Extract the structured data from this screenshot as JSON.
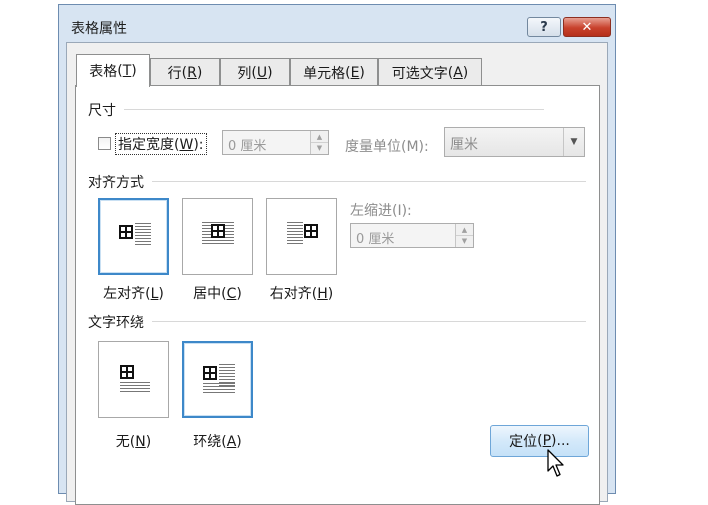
{
  "window": {
    "title": "表格属性",
    "help_label": "?",
    "close_label": "✕"
  },
  "tabs": [
    {
      "label": "表格",
      "hotkey": "T",
      "active": true
    },
    {
      "label": "行",
      "hotkey": "R",
      "active": false
    },
    {
      "label": "列",
      "hotkey": "U",
      "active": false
    },
    {
      "label": "单元格",
      "hotkey": "E",
      "active": false
    },
    {
      "label": "可选文字",
      "hotkey": "A",
      "active": false
    }
  ],
  "size_section": {
    "heading": "尺寸",
    "preferred_width_label": "指定宽度",
    "preferred_width_hotkey": "W",
    "preferred_width_checked": false,
    "width_value": "0 厘米",
    "measure_label": "度量单位(M):",
    "measure_value": "厘米"
  },
  "alignment_section": {
    "heading": "对齐方式",
    "options": [
      {
        "label": "左对齐",
        "hotkey": "L",
        "selected": true
      },
      {
        "label": "居中",
        "hotkey": "C",
        "selected": false
      },
      {
        "label": "右对齐",
        "hotkey": "H",
        "selected": false
      }
    ],
    "indent_label": "左缩进(I):",
    "indent_value": "0 厘米"
  },
  "wrap_section": {
    "heading": "文字环绕",
    "options": [
      {
        "label": "无",
        "hotkey": "N",
        "selected": false
      },
      {
        "label": "环绕",
        "hotkey": "A",
        "selected": true
      }
    ]
  },
  "position_button": {
    "label": "定位",
    "hotkey": "P",
    "suffix": "..."
  },
  "colors": {
    "selection_border": "#3d88c9",
    "close_button": "#c8412c",
    "title_bar": "#d7e4f2"
  },
  "icons": {
    "table": "table-grid-icon",
    "text_lines": "text-lines-icon",
    "cursor": "mouse-pointer-icon"
  }
}
